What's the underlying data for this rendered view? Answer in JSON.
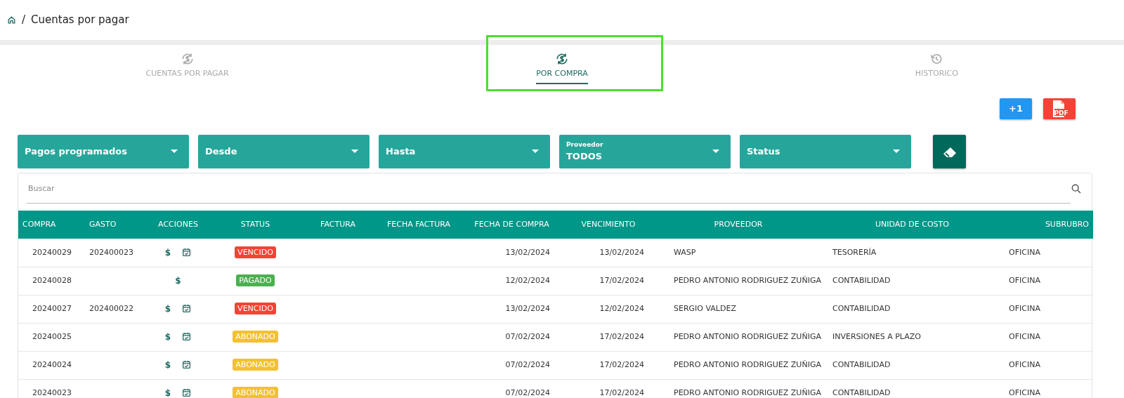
{
  "breadcrumb": {
    "separator": "/",
    "title": "Cuentas por pagar"
  },
  "tabs": [
    {
      "label": "CUENTAS POR PAGAR",
      "selected": false,
      "highlighted": false
    },
    {
      "label": "POR COMPRA",
      "selected": true,
      "highlighted": true
    },
    {
      "label": "HISTORICO",
      "selected": false,
      "highlighted": false
    }
  ],
  "actions": [
    {
      "kind": "plus",
      "label": "+1"
    },
    {
      "kind": "pdf",
      "label": "PDF"
    }
  ],
  "filters": [
    {
      "label": "Pagos programados"
    },
    {
      "label": "Desde"
    },
    {
      "label": "Hasta"
    },
    {
      "label": "Proveedor",
      "value": "TODOS"
    },
    {
      "label": "Status"
    }
  ],
  "search": {
    "placeholder": "Buscar"
  },
  "table": {
    "columns": [
      "COMPRA",
      "GASTO",
      "ACCIONES",
      "STATUS",
      "FACTURA",
      "FECHA FACTURA",
      "FECHA DE COMPRA",
      "VENCIMIENTO",
      "PROVEEDOR",
      "UNIDAD DE COSTO",
      "SUBRUBRO"
    ],
    "rows": [
      {
        "compra": "20240029",
        "gasto": "202400023",
        "pay": "$",
        "schedule": true,
        "status": "VENCIDO",
        "color": "#f44336",
        "fecha_compra": "13/02/2024",
        "vencimiento": "13/02/2024",
        "proveedor": "WASP",
        "unidad": "TESORERÍA",
        "subrubro": "OFICINA"
      },
      {
        "compra": "20240028",
        "pay": "$",
        "schedule": false,
        "status": "PAGADO",
        "color": "#4caf50",
        "fecha_compra": "12/02/2024",
        "vencimiento": "17/02/2024",
        "proveedor": "PEDRO ANTONIO RODRIGUEZ ZUÑIGA",
        "unidad": "CONTABILIDAD",
        "subrubro": "OFICINA"
      },
      {
        "compra": "20240027",
        "gasto": "202400022",
        "pay": "$",
        "schedule": true,
        "status": "VENCIDO",
        "color": "#f44336",
        "fecha_compra": "13/02/2024",
        "vencimiento": "12/02/2024",
        "proveedor": "SERGIO VALDEZ",
        "unidad": "CONTABILIDAD",
        "subrubro": "OFICINA"
      },
      {
        "compra": "20240025",
        "pay": "$",
        "schedule": true,
        "status": "ABONADO",
        "color": "#f2c12e",
        "fecha_compra": "07/02/2024",
        "vencimiento": "17/02/2024",
        "proveedor": "PEDRO ANTONIO RODRIGUEZ ZUÑIGA",
        "unidad": "INVERSIONES A PLAZO",
        "subrubro": "OFICINA"
      },
      {
        "compra": "20240024",
        "pay": "$",
        "schedule": true,
        "status": "ABONADO",
        "color": "#f2c12e",
        "fecha_compra": "07/02/2024",
        "vencimiento": "17/02/2024",
        "proveedor": "PEDRO ANTONIO RODRIGUEZ ZUÑIGA",
        "unidad": "CONTABILIDAD",
        "subrubro": "OFICINA"
      },
      {
        "compra": "20240023",
        "pay": "$",
        "schedule": true,
        "status": "ABONADO",
        "color": "#f2c12e",
        "fecha_compra": "07/02/2024",
        "vencimiento": "17/02/2024",
        "proveedor": "PEDRO ANTONIO RODRIGUEZ ZUÑIGA",
        "unidad": "CONTABILIDAD",
        "subrubro": "OFICINA"
      }
    ]
  }
}
